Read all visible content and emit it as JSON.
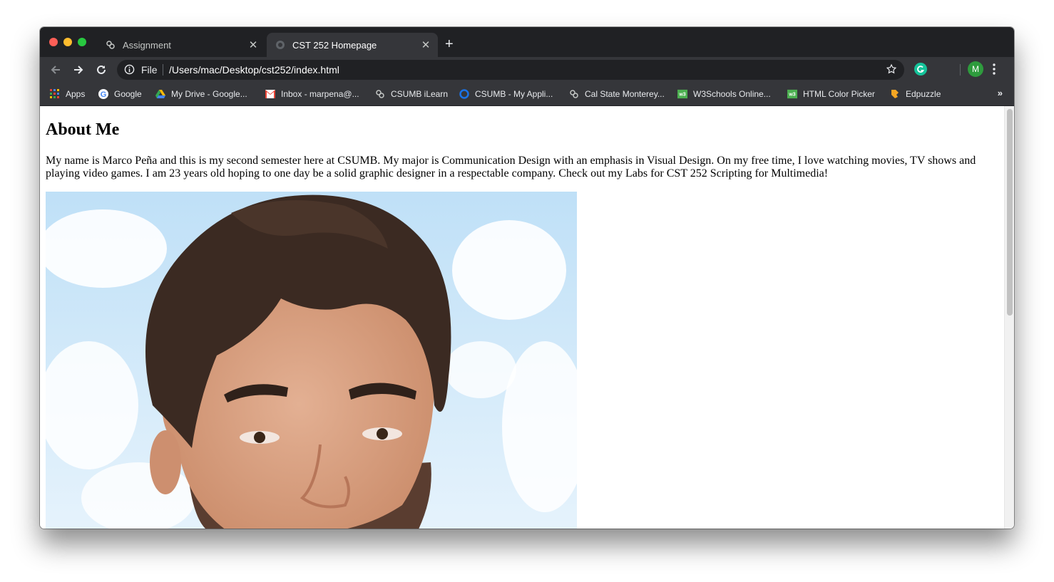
{
  "browser": {
    "tabs": [
      {
        "title": "Assignment",
        "active": false,
        "icon": "moodle-icon"
      },
      {
        "title": "CST 252 Homepage",
        "active": true,
        "icon": "globe-icon"
      }
    ],
    "address": {
      "scheme_label": "File",
      "url": "/Users/mac/Desktop/cst252/index.html"
    },
    "profile_initial": "M",
    "bookmarks": [
      {
        "label": "Apps",
        "icon": "apps-grid-icon"
      },
      {
        "label": "Google",
        "icon": "google-icon"
      },
      {
        "label": "My Drive - Google...",
        "icon": "drive-icon"
      },
      {
        "label": "Inbox - marpena@...",
        "icon": "gmail-icon"
      },
      {
        "label": "CSUMB iLearn",
        "icon": "moodle-icon"
      },
      {
        "label": "CSUMB - My Appli...",
        "icon": "ring-icon"
      },
      {
        "label": "Cal State Monterey...",
        "icon": "moodle-icon"
      },
      {
        "label": "W3Schools Online...",
        "icon": "w3schools-icon"
      },
      {
        "label": "HTML Color Picker",
        "icon": "w3schools-icon"
      },
      {
        "label": "Edpuzzle",
        "icon": "edpuzzle-icon"
      }
    ],
    "bookmarks_more": "»"
  },
  "page": {
    "heading": "About Me",
    "bio": "My name is Marco Peña and this is my second semester here at CSUMB. My major is Communication Design with an emphasis in Visual Design. On my free time, I love watching movies, TV shows and playing video games. I am 23 years old hoping to one day be a solid graphic designer in a respectable company. Check out my Labs for CST 252 Scripting for Multimedia!"
  },
  "colors": {
    "tabstrip": "#202124",
    "toolbar": "#35363a",
    "sky": "#a9d3f2",
    "hair": "#3b2a22",
    "skin": "#d9a07e"
  }
}
